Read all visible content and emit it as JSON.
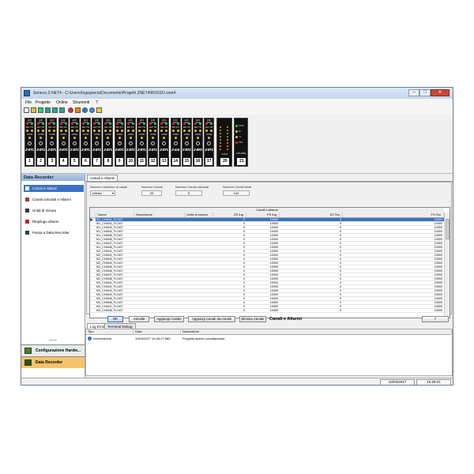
{
  "window": {
    "title": "Seneca Z-NET4 - C:\\Users\\Ingegneria\\Documents\\Progetti ZNET4\\ROSSO.znet4",
    "controls": [
      "–",
      "□",
      "✕"
    ]
  },
  "menu": [
    "File",
    "Progetto",
    "Online",
    "Strumenti",
    "?"
  ],
  "toolbar_icons": [
    "new-icon",
    "open-icon",
    "save-icon",
    "module-icon",
    "module-icon",
    "module-icon",
    "stop-icon",
    "settings-icon",
    "help-icon",
    "globe-icon",
    "info-icon"
  ],
  "modules": {
    "header_labels": [
      "ERR",
      "PWR",
      "RX",
      "TX",
      "COM"
    ],
    "items": [
      {
        "model": "Z-8TC",
        "number": "1"
      },
      {
        "model": "Z-8TC",
        "number": "2"
      },
      {
        "model": "Z-8TC",
        "number": "3"
      },
      {
        "model": "Z-8TC",
        "number": "4"
      },
      {
        "model": "Z-8TC",
        "number": "5"
      },
      {
        "model": "Z-8TC",
        "number": "6"
      },
      {
        "model": "Z-8TC",
        "number": "7"
      },
      {
        "model": "Z-8TC",
        "number": "8"
      },
      {
        "model": "Z-8TC",
        "number": "9"
      },
      {
        "model": "Z-8TC",
        "number": "10"
      },
      {
        "model": "Z-8TC",
        "number": "11"
      },
      {
        "model": "Z-8TC",
        "number": "12"
      },
      {
        "model": "Z-8TC",
        "number": "13"
      },
      {
        "model": "Z-4AI",
        "number": "14"
      },
      {
        "model": "Z-8TC",
        "number": "15"
      },
      {
        "model": "Z-8RTD",
        "number": "16"
      },
      {
        "model": "Z-8TC",
        "number": "17"
      }
    ],
    "module20": {
      "brand": "Z-D-IN",
      "number": "20"
    },
    "module21": {
      "labels": [
        "PWR",
        "Rx",
        "Tx",
        "FAIL"
      ],
      "brand": "Z-PC-DINAL",
      "number": "21"
    }
  },
  "left_panel": {
    "title": "Data Recorder",
    "items": [
      {
        "label": "Canali e Allarmi",
        "selected": true
      },
      {
        "label": "Canali calcolati e Allarmi",
        "selected": false
      },
      {
        "label": "Unità di misura",
        "selected": false
      },
      {
        "label": "Riepilogo allarmi",
        "selected": false
      },
      {
        "label": "Passa a Data Recorder",
        "selected": false
      }
    ],
    "bottom_items": [
      "Configurazione Hardw...",
      "Data Recorder"
    ]
  },
  "main": {
    "tab": "Canali e Allarmi",
    "fields": {
      "max_label": "Numero massimo di canali",
      "max_value": "Infinito",
      "canali_label": "Numero Canali",
      "canali_value": "99",
      "calcolati_label": "Numero Canali calcolati",
      "calcolati_value": "5",
      "totali_label": "Numero Canali totali",
      "totali_value": "104"
    },
    "grid_title": "Canali e Allarmi",
    "columns": [
      "Nome",
      "Descrizione",
      "Unità di misura",
      "ZS Ing.",
      "FS Ing.",
      "ZS Tec.",
      "FS Tec."
    ],
    "rows": [
      [
        "M1_CHAN1_FLOAT",
        "",
        "",
        "0",
        "10000",
        "0",
        "10000"
      ],
      [
        "M1_CHAN2_FLOAT",
        "",
        "",
        "0",
        "10000",
        "0",
        "10000"
      ],
      [
        "M1_CHAN3_FLOAT",
        "",
        "",
        "0",
        "10000",
        "0",
        "10000"
      ],
      [
        "M1_CHAN4_FLOAT",
        "",
        "",
        "0",
        "10000",
        "0",
        "10000"
      ],
      [
        "M1_CHAN5_FLOAT",
        "",
        "",
        "0",
        "10000",
        "0",
        "10000"
      ],
      [
        "M1_CHAN6_FLOAT",
        "",
        "",
        "0",
        "10000",
        "0",
        "10000"
      ],
      [
        "M1_CHAN7_FLOAT",
        "",
        "",
        "0",
        "10000",
        "0",
        "10000"
      ],
      [
        "M1_CHAN8_FLOAT",
        "",
        "",
        "0",
        "10000",
        "0",
        "10000"
      ],
      [
        "M2_CHAN1_FLOAT",
        "",
        "",
        "0",
        "10000",
        "0",
        "10000"
      ],
      [
        "M2_CHAN2_FLOAT",
        "",
        "",
        "0",
        "10000",
        "0",
        "10000"
      ],
      [
        "M2_CHAN3_FLOAT",
        "",
        "",
        "0",
        "10000",
        "0",
        "10000"
      ],
      [
        "M2_CHAN4_FLOAT",
        "",
        "",
        "0",
        "10000",
        "0",
        "10000"
      ],
      [
        "M2_CHAN5_FLOAT",
        "",
        "",
        "0",
        "10000",
        "0",
        "10000"
      ],
      [
        "M2_CHAN6_FLOAT",
        "",
        "",
        "0",
        "10000",
        "0",
        "10000"
      ],
      [
        "M2_CHAN7_FLOAT",
        "",
        "",
        "0",
        "10000",
        "0",
        "10000"
      ],
      [
        "M2_CHAN8_FLOAT",
        "",
        "",
        "0",
        "10000",
        "0",
        "10000"
      ],
      [
        "M3_CHAN1_FLOAT",
        "",
        "",
        "0",
        "10000",
        "0",
        "10000"
      ],
      [
        "M3_CHAN2_FLOAT",
        "",
        "",
        "0",
        "10000",
        "0",
        "10000"
      ],
      [
        "M3_CHAN3_FLOAT",
        "",
        "",
        "0",
        "10000",
        "0",
        "10000"
      ],
      [
        "M3_CHAN4_FLOAT",
        "",
        "",
        "0",
        "10000",
        "0",
        "10000"
      ],
      [
        "M3_CHAN5_FLOAT",
        "",
        "",
        "0",
        "10000",
        "0",
        "10000"
      ],
      [
        "M3_CHAN6_FLOAT",
        "",
        "",
        "0",
        "10000",
        "0",
        "10000"
      ],
      [
        "M3_CHAN7_FLOAT",
        "",
        "",
        "0",
        "10000",
        "0",
        "10000"
      ],
      [
        "M3_CHAN8_FLOAT",
        "",
        "",
        "0",
        "10000",
        "0",
        "10000"
      ]
    ],
    "buttons": {
      "ok": "OK",
      "annulla": "Annulla",
      "aggiungi": "Aggiungi Canale",
      "aggiungi_moduli": "Aggiungi Canali da moduli",
      "elimina": "Elimina Canale",
      "section_title": "Canali e Allarmi",
      "help": "?"
    },
    "log": {
      "tabs": [
        "Log Errori",
        "Terminal Debug"
      ],
      "columns": [
        "Tipo",
        "Data",
        "Descrizione"
      ],
      "entries": [
        {
          "tipo": "Informazione",
          "data": "10/04/2017 16:28:27:989",
          "descrizione": "Progetto aperto correttamente."
        }
      ]
    }
  },
  "status": {
    "date": "10/04/2017",
    "time": "16:29:21"
  },
  "colors": {
    "selection": "#3a72c8",
    "module_bg": "#111111",
    "accent_bottom": "#f5c36b"
  }
}
